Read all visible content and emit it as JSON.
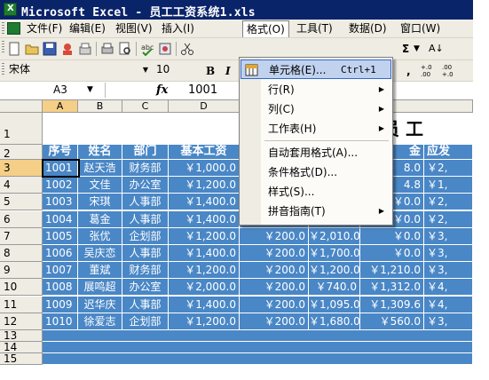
{
  "window": {
    "title": "Microsoft Excel - 员工工资系统1.xls"
  },
  "menubar": {
    "items": [
      "文件(F)",
      "编辑(E)",
      "视图(V)",
      "插入(I)",
      "格式(O)",
      "工具(T)",
      "数据(D)",
      "窗口(W)"
    ]
  },
  "toolbar": {
    "sum_label": "Σ",
    "sort_label": "A↓"
  },
  "format_toolbar": {
    "font_name": "宋体",
    "font_size": "10",
    "bold_label": "B",
    "italic_label": "I",
    "comma_label": ",",
    "inc_decimal_label": "+.0 .00",
    "dec_decimal_label": ".00 +.0"
  },
  "formula_bar": {
    "name_box": "A3",
    "fx_label": "fx",
    "formula": "1001"
  },
  "sheet": {
    "columns": [
      "A",
      "B",
      "C",
      "D"
    ],
    "title_partial": "员 工",
    "rows": [
      "1",
      "2",
      "3",
      "4",
      "5",
      "6",
      "7",
      "8",
      "9",
      "10",
      "11",
      "12",
      "13",
      "14",
      "15"
    ],
    "header": {
      "a": "序号",
      "b": "姓名",
      "c": "部门",
      "d": "基本工资",
      "h": "金",
      "i": "应发"
    },
    "data": [
      {
        "id": "1001",
        "name": "赵天浩",
        "dept": "财务部",
        "base": "￥1,000.0",
        "g": "",
        "h": "8.0",
        "i": "￥2,"
      },
      {
        "id": "1002",
        "name": "文佳",
        "dept": "办公室",
        "base": "￥1,200.0",
        "g": "",
        "h": "4.8",
        "i": "￥1,"
      },
      {
        "id": "1003",
        "name": "宋琪",
        "dept": "人事部",
        "base": "￥1,400.0",
        "e": "￥200.0",
        "g": "￥885.0",
        "h": "￥0.0",
        "i": "￥2,"
      },
      {
        "id": "1004",
        "name": "葛金",
        "dept": "人事部",
        "base": "￥1,400.0",
        "e": "￥200.0",
        "g": "￥1,065.0",
        "h": "￥0.0",
        "i": "￥2,"
      },
      {
        "id": "1005",
        "name": "张优",
        "dept": "企划部",
        "base": "￥1,200.0",
        "e": "￥200.0",
        "g": "￥2,010.0",
        "h": "￥0.0",
        "i": "￥3,"
      },
      {
        "id": "1006",
        "name": "吴庆恋",
        "dept": "人事部",
        "base": "￥1,400.0",
        "e": "￥200.0",
        "g": "￥1,700.0",
        "h": "￥0.0",
        "i": "￥3,"
      },
      {
        "id": "1007",
        "name": "董斌",
        "dept": "财务部",
        "base": "￥1,200.0",
        "e": "￥200.0",
        "g": "￥1,200.0",
        "h": "￥1,210.0",
        "i": "￥3,"
      },
      {
        "id": "1008",
        "name": "展鸣超",
        "dept": "办公室",
        "base": "￥2,000.0",
        "e": "￥200.0",
        "g": "￥740.0",
        "h": "￥1,312.0",
        "i": "￥4,"
      },
      {
        "id": "1009",
        "name": "迟华庆",
        "dept": "人事部",
        "base": "￥1,400.0",
        "e": "￥200.0",
        "g": "￥1,095.0",
        "h": "￥1,309.6",
        "i": "￥4,"
      },
      {
        "id": "1010",
        "name": "徐爱志",
        "dept": "企划部",
        "base": "￥1,200.0",
        "e": "￥200.0",
        "g": "￥1,680.0",
        "h": "￥560.0",
        "i": "￥3,"
      }
    ]
  },
  "format_menu": {
    "items": [
      {
        "label": "单元格(E)...",
        "shortcut": "Ctrl+1"
      },
      {
        "label": "行(R)"
      },
      {
        "label": "列(C)"
      },
      {
        "label": "工作表(H)"
      },
      {
        "label": "自动套用格式(A)..."
      },
      {
        "label": "条件格式(D)..."
      },
      {
        "label": "样式(S)..."
      },
      {
        "label": "拼音指南(T)"
      }
    ]
  },
  "colors": {
    "title_bar": "#0a246a",
    "table_fill": "#4a87c6",
    "menu_highlight": "#c1d2ee",
    "header_selected": "#f5cf87"
  }
}
